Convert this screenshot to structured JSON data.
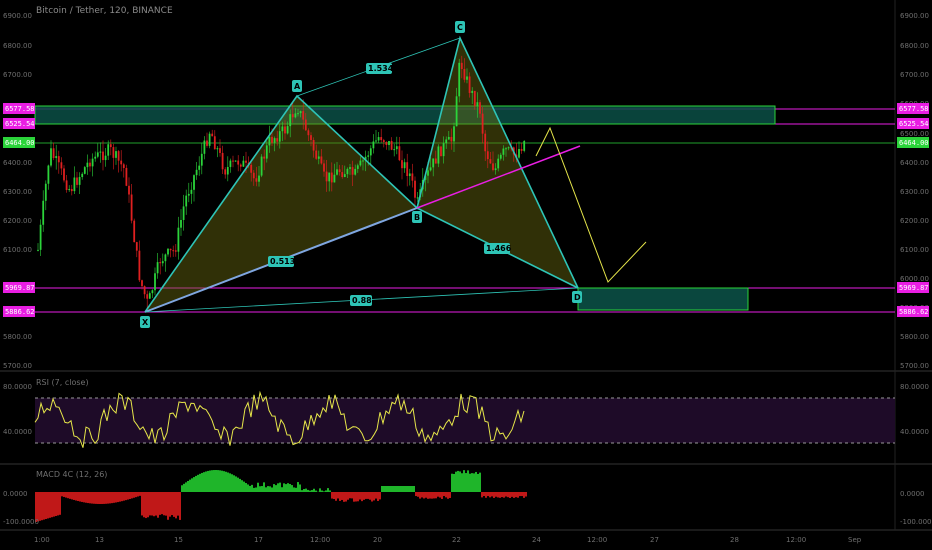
{
  "header": {
    "title": "Bitcoin / Tether, 120, BINANCE"
  },
  "rsi": {
    "title": "RSI (7, close)",
    "axis": [
      "80.0000",
      "40.0000"
    ]
  },
  "macd": {
    "title": "MACD 4C (12, 26)",
    "axis": [
      "0.0000",
      "-100.0000"
    ]
  },
  "price_axis": {
    "ticks": [
      "6900.00",
      "6800.00",
      "6700.00",
      "6600.00",
      "6500.00",
      "6400.00",
      "6300.00",
      "6200.00",
      "6100.00",
      "6000.00",
      "5900.00",
      "5800.00",
      "5700.00"
    ],
    "tags_left": [
      {
        "label": "6577.58",
        "color": "#e91ee3"
      },
      {
        "label": "6525.54",
        "color": "#e91ee3"
      },
      {
        "label": "6464.00",
        "color": "#2bd43a"
      },
      {
        "label": "5969.87",
        "color": "#e91ee3"
      },
      {
        "label": "5886.62",
        "color": "#e91ee3"
      }
    ],
    "tags_right": [
      {
        "label": "6577.58",
        "color": "#e91ee3"
      },
      {
        "label": "6525.54",
        "color": "#e91ee3"
      },
      {
        "label": "6464.00",
        "color": "#2bd43a"
      },
      {
        "label": "5969.87",
        "color": "#e91ee3"
      },
      {
        "label": "5886.62",
        "color": "#e91ee3"
      }
    ]
  },
  "time_axis": [
    "1:00",
    "13",
    "15",
    "17",
    "12:00",
    "20",
    "22",
    "24",
    "12:00",
    "27",
    "28",
    "12:00",
    "Sep"
  ],
  "pattern": {
    "points": [
      "X",
      "A",
      "B",
      "C",
      "D"
    ],
    "ratios": [
      "0.513",
      "1.534",
      "1.466",
      "0.88"
    ]
  },
  "colors": {
    "background": "#000000",
    "pattern_line": "#2ec4b6",
    "pattern_fill": "#6b6b10",
    "zone": "#0b4f45",
    "zone_border": "#2bd43a",
    "magenta": "#e91ee3",
    "rsi_line": "#e6e64a",
    "rsi_band": "#1e0b28",
    "up_candle": "#2bd43a",
    "down_candle": "#e02020"
  }
}
